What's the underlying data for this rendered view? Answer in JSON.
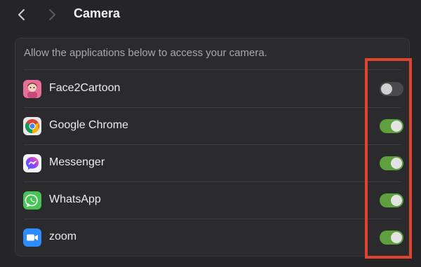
{
  "header": {
    "title": "Camera",
    "back_icon": "chevron-left-icon",
    "forward_icon": "chevron-right-icon"
  },
  "panel": {
    "description": "Allow the applications below to access your camera."
  },
  "apps": [
    {
      "name": "Face2Cartoon",
      "icon": "face2cartoon-app-icon",
      "enabled": false
    },
    {
      "name": "Google Chrome",
      "icon": "google-chrome-app-icon",
      "enabled": true
    },
    {
      "name": "Messenger",
      "icon": "messenger-app-icon",
      "enabled": true
    },
    {
      "name": "WhatsApp",
      "icon": "whatsapp-app-icon",
      "enabled": true
    },
    {
      "name": "zoom",
      "icon": "zoom-app-icon",
      "enabled": true
    }
  ],
  "colors": {
    "toggle_on": "#5e9f3e",
    "toggle_off": "#4a494b",
    "highlight": "#e0432f"
  }
}
